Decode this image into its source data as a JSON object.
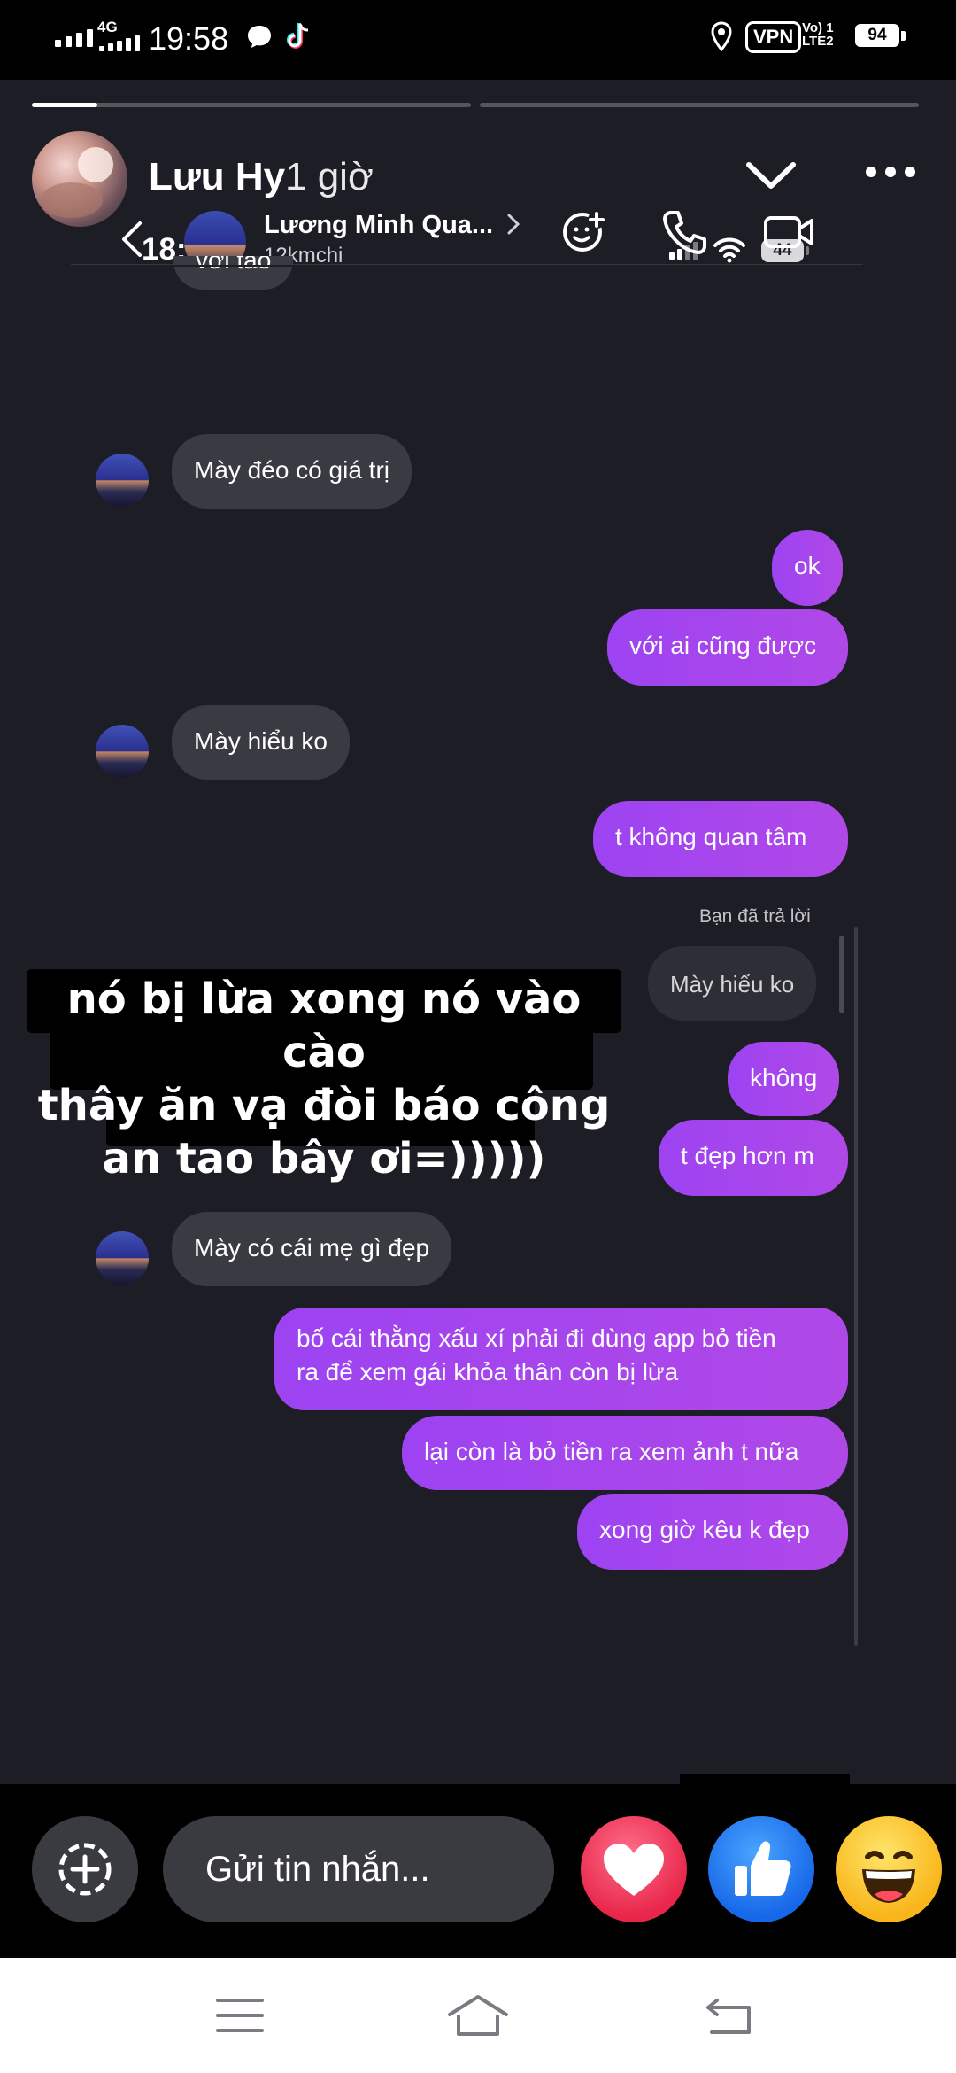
{
  "status_bar": {
    "network": "4G",
    "time": "19:58",
    "vpn": "VPN",
    "volte_line1": "Vo) 1",
    "volte_line2": "LTE2",
    "battery": "94",
    "icons": [
      "signal-icon",
      "messenger-icon",
      "tiktok-icon",
      "location-icon",
      "vpn-icon",
      "volte-icon",
      "battery-icon"
    ]
  },
  "story": {
    "author": "Lưu Hy",
    "posted": "1 giờ",
    "progress": [
      1.0,
      0.0
    ],
    "progress_current": 0.15,
    "icons": [
      "chevron-down-icon",
      "more-icon"
    ]
  },
  "inner_screen": {
    "time": "18:05",
    "battery": "44",
    "contact_name": "Lương Minh Qua...",
    "contact_username": "12kmchi",
    "header_icons": [
      "back-icon",
      "add-people-icon",
      "phone-icon",
      "video-icon"
    ]
  },
  "messages": {
    "partial_top": "với tao",
    "m1": "Mày đéo có giá trị",
    "m2": "ok",
    "m3": "với ai cũng được",
    "m4": "Mày hiểu ko",
    "m5": "t không quan tâm",
    "reply_label": "Bạn đã trả lời",
    "reply_quote": "Mày hiểu ko",
    "m6": "không",
    "m7": "t đẹp hơn m",
    "m8": "Mày có cái mẹ gì đẹp",
    "m9_line1": "bố cái thằng xấu xí phải đi dùng app bỏ tiền",
    "m9_line2": "ra để xem gái khỏa thân còn bị lừa",
    "m10": "lại còn là bỏ tiền ra xem ảnh t nữa",
    "m11": "xong giờ kêu k đẹp"
  },
  "caption": {
    "line1": "nó bị lừa xong nó vào cào",
    "line2": "thây ăn vạ đòi báo công",
    "line3": "an tao bây ơi=)))))"
  },
  "reply_bar": {
    "placeholder": "Gửi tin nhắn...",
    "icons": [
      "add-icon",
      "heart-reaction-icon",
      "like-reaction-icon",
      "laugh-reaction-icon"
    ]
  },
  "nav_bar": {
    "icons": [
      "menu-icon",
      "home-icon",
      "back-nav-icon"
    ]
  },
  "colors": {
    "story_bg": "#1d1d25",
    "incoming_bubble": "#3a3b42",
    "outgoing_bubble": "#a545ee",
    "accent_heart": "#e8264a",
    "accent_like": "#1768e8"
  }
}
